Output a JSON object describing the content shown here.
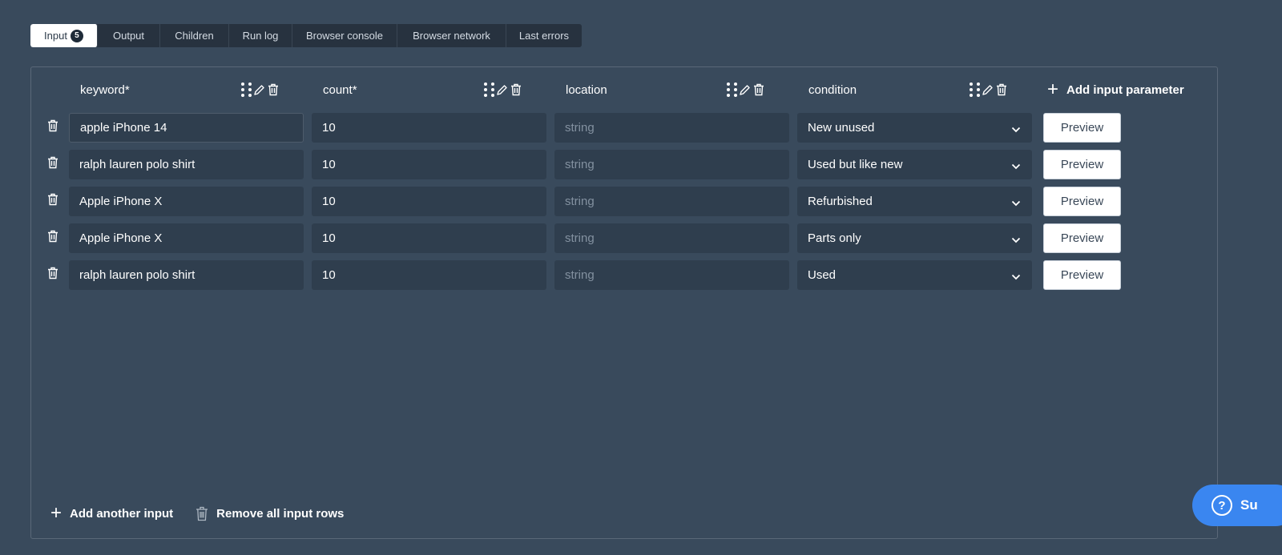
{
  "tabs": [
    {
      "label": "Input",
      "badge": "5"
    },
    {
      "label": "Output"
    },
    {
      "label": "Children"
    },
    {
      "label": "Run log"
    },
    {
      "label": "Browser console"
    },
    {
      "label": "Browser network"
    },
    {
      "label": "Last errors"
    }
  ],
  "columns": [
    "keyword*",
    "count*",
    "location",
    "condition"
  ],
  "add_parameter_label": "Add input parameter",
  "rows": [
    {
      "keyword": "apple iPhone 14",
      "count": "10",
      "location_placeholder": "string",
      "condition": "New unused"
    },
    {
      "keyword": "ralph lauren polo shirt",
      "count": "10",
      "location_placeholder": "string",
      "condition": "Used but like new"
    },
    {
      "keyword": "Apple iPhone X",
      "count": "10",
      "location_placeholder": "string",
      "condition": "Refurbished"
    },
    {
      "keyword": "Apple iPhone X",
      "count": "10",
      "location_placeholder": "string",
      "condition": "Parts only"
    },
    {
      "keyword": "ralph lauren polo shirt",
      "count": "10",
      "location_placeholder": "string",
      "condition": "Used"
    }
  ],
  "preview_label": "Preview",
  "footer": {
    "add_input_label": "Add another input",
    "remove_rows_label": "Remove all input rows"
  },
  "support_label": "Su",
  "icons": {
    "drag": "drag-handle-icon",
    "edit": "pencil-icon",
    "delete": "trash-icon",
    "chevron": "chevron-down-icon",
    "help": "question-circle-icon"
  },
  "colors": {
    "background": "#394a5c",
    "cell": "#2f3e4e",
    "accent": "#3a86f0"
  }
}
